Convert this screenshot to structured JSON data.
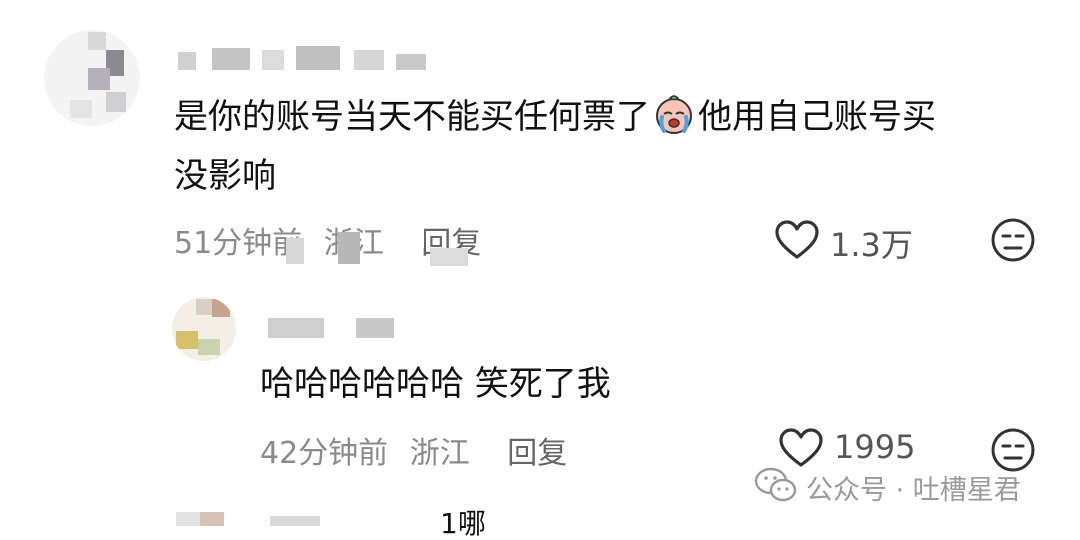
{
  "comments": [
    {
      "text_line1_a": "是你的账号当天不能买任何票了",
      "text_line1_b": "他用自己账号买",
      "text_line2": "没影响",
      "time": "51分钟前",
      "location": "浙江",
      "reply_label": "回复",
      "likes": "1.3万",
      "emoji_icon": "crying-baby-emoji-icon"
    },
    {
      "text": "哈哈哈哈哈哈 笑死了我",
      "time": "42分钟前",
      "location": "浙江",
      "reply_label": "回复",
      "likes": "1995"
    },
    {
      "partial_text": "1哪"
    }
  ],
  "watermark": {
    "text": "公众号 · 吐槽星君",
    "icon": "wechat-icon"
  },
  "colors": {
    "text": "#111111",
    "meta": "#8a8a8a",
    "icon_stroke": "#333333"
  }
}
